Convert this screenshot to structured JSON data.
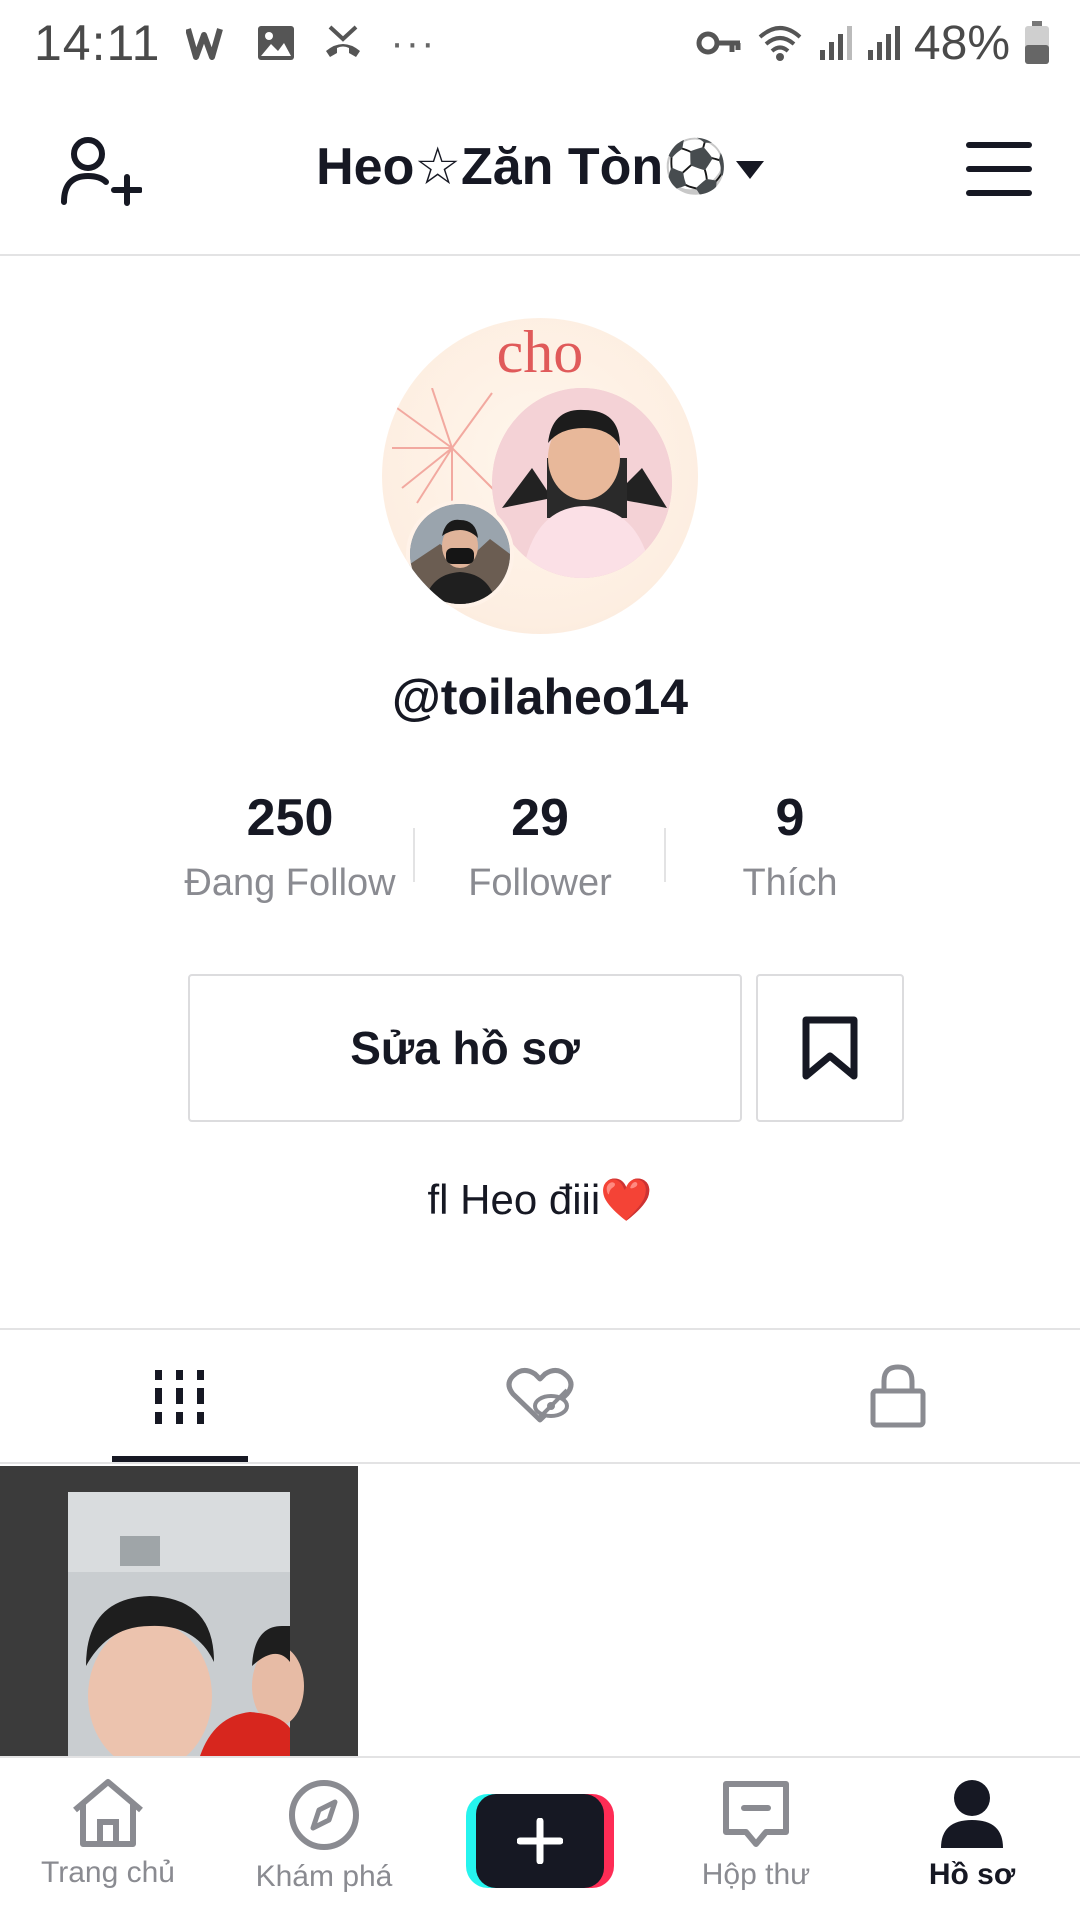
{
  "status_bar": {
    "time": "14:11",
    "more_dots": "···",
    "battery_percent": "48%",
    "icons": [
      "w-app-icon",
      "image-icon",
      "missed-call-icon",
      "more-icon",
      "key-icon",
      "wifi-icon",
      "signal-icon",
      "signal-icon",
      "battery-icon"
    ]
  },
  "header": {
    "account_name": "Heo☆Zăn Tòn⚽",
    "icons": [
      "add-user-icon",
      "caret-down-icon",
      "menu-icon"
    ]
  },
  "profile": {
    "avatar_text": "cho",
    "username": "@toilaheo14",
    "stats": [
      {
        "value": "250",
        "label": "Đang Follow"
      },
      {
        "value": "29",
        "label": "Follower"
      },
      {
        "value": "9",
        "label": "Thích"
      }
    ],
    "edit_button": "Sửa hồ sơ",
    "bio": "fl Heo điii",
    "bio_emoji": "❤️"
  },
  "tabs": {
    "items": [
      "videos-grid-icon",
      "liked-hidden-icon",
      "lock-icon"
    ],
    "active_index": 0
  },
  "bottom_nav": {
    "items": [
      {
        "label": "Trang chủ",
        "icon": "home-icon"
      },
      {
        "label": "Khám phá",
        "icon": "compass-icon"
      },
      {
        "label": "",
        "icon": "plus-icon"
      },
      {
        "label": "Hộp thư",
        "icon": "inbox-icon"
      },
      {
        "label": "Hồ sơ",
        "icon": "profile-icon"
      }
    ],
    "active_index": 4
  },
  "colors": {
    "text_primary": "#161823",
    "text_secondary": "#8a8b91",
    "divider": "#e3e3e4",
    "create_cyan": "#25f4ee",
    "create_pink": "#fe2c55",
    "heart_red": "#e81f3a"
  }
}
